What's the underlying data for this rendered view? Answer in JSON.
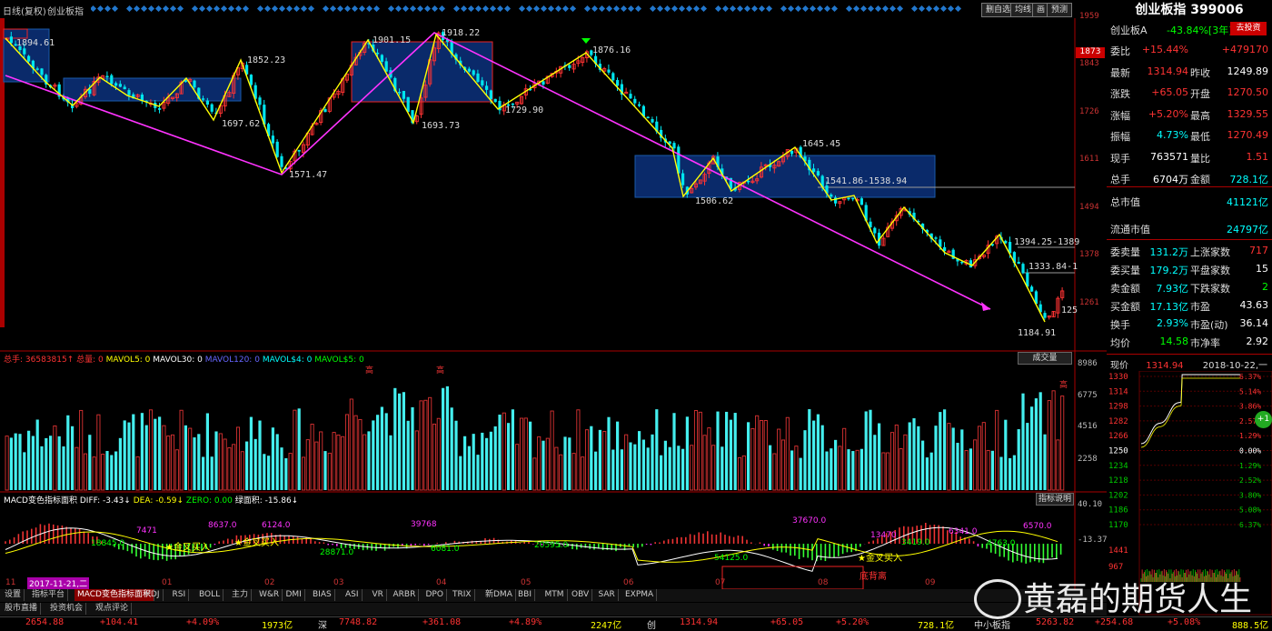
{
  "top_bar": {
    "period_label": "日线(复权)",
    "index_label": "创业板指",
    "buttons": [
      "删自选",
      "均线",
      "画",
      "预测"
    ]
  },
  "main_chart": {
    "price_ticks": [
      "1959",
      "1873",
      "1843",
      "1726",
      "1611",
      "1494",
      "1378",
      "1261"
    ],
    "current_price_tag": "1873",
    "price_labels": [
      "1894.61",
      "1852.23",
      "1901.15",
      "1918.22",
      "1876.16",
      "1697.62",
      "1571.47",
      "1693.73",
      "1729.90",
      "1645.45",
      "1541.86-1538.94",
      "1506.62",
      "1394.25-1389",
      "1333.84-1",
      "1184.91",
      "125"
    ]
  },
  "volume_panel": {
    "header": [
      "总手: 36583815↑",
      "总量: 0",
      "MAVOL5: 0",
      "MAVOL30: 0",
      "MAVOL120: 0",
      "MAVOL$4: 0",
      "MAVOL$5: 0"
    ],
    "button": "成交量",
    "ticks": [
      "8986",
      "6775",
      "4516",
      "2258"
    ],
    "high_labels": [
      "高",
      "高",
      "高"
    ]
  },
  "macd_panel": {
    "header": [
      "MACD变色指标面积",
      "DIFF: -3.43↓",
      "DEA: -0.59↓",
      "ZERO: 0.00",
      "绿面积: -15.86↓"
    ],
    "button": "指标说明",
    "ticks": [
      "40.10",
      "-13.37"
    ],
    "area_labels": [
      "7471",
      "8637.0",
      "6124.0",
      "39768",
      "37670.0",
      "18845.0",
      "28871.0",
      "6081.0",
      "20595.0",
      "54125.0",
      "13470",
      "3419.0",
      "6341.0",
      "4763.0",
      "6570.0"
    ],
    "signals": [
      "金叉买入",
      "金叉买入",
      "金叉买入",
      "底背离"
    ]
  },
  "date_axis": [
    "11",
    "2017-11-21,二",
    "01",
    "02",
    "03",
    "04",
    "05",
    "06",
    "07",
    "08",
    "09"
  ],
  "indicator_tabs": [
    "设置",
    "指标平台",
    "MACD变色指标面积",
    "KDJ",
    "RSI",
    "BOLL",
    "主力",
    "W&R",
    "DMI",
    "BIAS",
    "ASI",
    "VR",
    "ARBR",
    "DPO",
    "TRIX",
    "新DMA",
    "BBI",
    "MTM",
    "OBV",
    "SAR",
    "EXPMA"
  ],
  "bottom_tabs": [
    "股市直播",
    "投资机会",
    "观点评论"
  ],
  "right_panel": {
    "title": "创业板指 399006",
    "subtitle": "创业板A",
    "change_3y": "-43.84%[3年]",
    "action_button": "去投资",
    "rows": [
      {
        "k1": "委比",
        "v1": "+15.44%",
        "k2": "",
        "v2": "+479170"
      },
      {
        "k1": "最新",
        "v1": "1314.94",
        "k2": "昨收",
        "v2": "1249.89"
      },
      {
        "k1": "涨跌",
        "v1": "+65.05",
        "k2": "开盘",
        "v2": "1270.50"
      },
      {
        "k1": "涨幅",
        "v1": "+5.20%",
        "k2": "最高",
        "v2": "1329.55"
      },
      {
        "k1": "振幅",
        "v1": "4.73%",
        "k2": "最低",
        "v2": "1270.49"
      },
      {
        "k1": "现手",
        "v1": "763571",
        "k2": "量比",
        "v2": "1.51"
      },
      {
        "k1": "总手",
        "v1": "6704万",
        "k2": "金额",
        "v2": "728.1亿"
      }
    ],
    "market_cap": {
      "k": "总市值",
      "v": "41121亿"
    },
    "float_cap": {
      "k": "流通市值",
      "v": "24797亿"
    },
    "rows2": [
      {
        "k1": "委卖量",
        "v1": "131.2万",
        "k2": "上涨家数",
        "v2": "717"
      },
      {
        "k1": "委买量",
        "v1": "179.2万",
        "k2": "平盘家数",
        "v2": "15"
      },
      {
        "k1": "卖金额",
        "v1": "7.93亿",
        "k2": "下跌家数",
        "v2": "2"
      },
      {
        "k1": "买金额",
        "v1": "17.13亿",
        "k2": "市盈",
        "v2": "43.63"
      },
      {
        "k1": "换手",
        "v1": "2.93%",
        "k2": "市盈(动)",
        "v2": "36.14"
      },
      {
        "k1": "均价",
        "v1": "14.58",
        "k2": "市净率",
        "v2": "2.92"
      }
    ],
    "intraday_header": {
      "k": "现价",
      "v": "1314.94",
      "date": "2018-10-22,一"
    },
    "intraday_left_ticks": [
      "1330",
      "1314",
      "1298",
      "1282",
      "1266",
      "1250",
      "1234",
      "1218",
      "1202",
      "1186",
      "1170"
    ],
    "intraday_right_ticks": [
      "6.37%",
      "5.14%",
      "3.86%",
      "2.57%",
      "1.29%",
      "0.00%",
      "1.29%",
      "2.52%",
      "3.80%",
      "5.08%",
      "6.37%"
    ],
    "volume_ticks": [
      "1441",
      "967"
    ],
    "side_badge": "+1"
  },
  "status_bar": {
    "items": [
      "2654.88",
      "+104.41",
      "+4.09%",
      "1973亿",
      "深",
      "7748.82",
      "+361.08",
      "+4.89%",
      "2247亿",
      "创",
      "1314.94",
      "+65.05",
      "+5.20%",
      "728.1亿",
      "中小板指",
      "5263.82",
      "+254.68",
      "+5.08%",
      "888.5亿"
    ]
  },
  "watermark": "黄磊的期货人生",
  "colors": {
    "up": "#ff3333",
    "down": "#00e5ee",
    "zigzag": "#ffff00",
    "trend": "#ff33ff",
    "box": "#0a2a6a"
  }
}
